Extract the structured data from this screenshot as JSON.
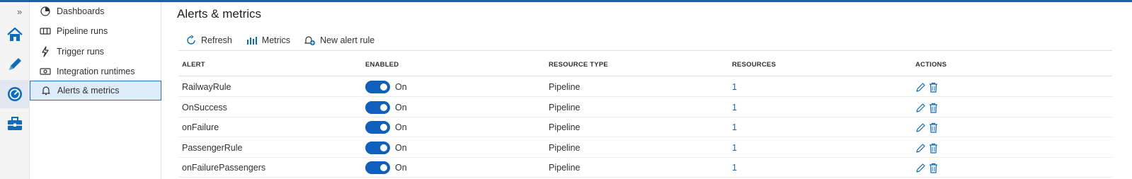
{
  "rail": {
    "expand_glyph": "»",
    "items": [
      {
        "name": "home",
        "icon": "home-icon",
        "active": false
      },
      {
        "name": "author",
        "icon": "pencil-icon",
        "active": false
      },
      {
        "name": "monitor",
        "icon": "gauge-icon",
        "active": true
      },
      {
        "name": "manage",
        "icon": "toolbox-icon",
        "active": false
      }
    ]
  },
  "subnav": {
    "items": [
      {
        "label": "Dashboards",
        "icon": "dashboard-icon"
      },
      {
        "label": "Pipeline runs",
        "icon": "pipeline-runs-icon"
      },
      {
        "label": "Trigger runs",
        "icon": "trigger-icon"
      },
      {
        "label": "Integration runtimes",
        "icon": "integration-runtime-icon"
      },
      {
        "label": "Alerts & metrics",
        "icon": "bell-icon"
      }
    ],
    "selected": "Alerts & metrics"
  },
  "main": {
    "title": "Alerts & metrics",
    "toolbar": {
      "refresh_label": "Refresh",
      "metrics_label": "Metrics",
      "new_alert_label": "New alert rule"
    },
    "table": {
      "columns": [
        "ALERT",
        "ENABLED",
        "RESOURCE TYPE",
        "RESOURCES",
        "ACTIONS"
      ],
      "rows": [
        {
          "alert": "RailwayRule",
          "enabled": "On",
          "resource_type": "Pipeline",
          "resources": "1"
        },
        {
          "alert": "OnSuccess",
          "enabled": "On",
          "resource_type": "Pipeline",
          "resources": "1"
        },
        {
          "alert": "onFailure",
          "enabled": "On",
          "resource_type": "Pipeline",
          "resources": "1"
        },
        {
          "alert": "PassengerRule",
          "enabled": "On",
          "resource_type": "Pipeline",
          "resources": "1"
        },
        {
          "alert": "onFailurePassengers",
          "enabled": "On",
          "resource_type": "Pipeline",
          "resources": "1"
        }
      ]
    }
  },
  "colors": {
    "accent": "#0f6cbd",
    "toggle_on": "#0f5fbd",
    "selected_bg": "#deecf9",
    "top_bar": "#1f5fb0"
  }
}
